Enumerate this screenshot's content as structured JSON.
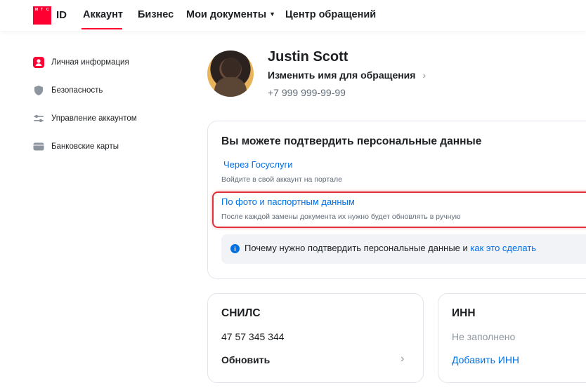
{
  "brand": {
    "logo_letters": [
      "М",
      "Т",
      "С"
    ],
    "id_label": "ID",
    "accent_color": "#ff0032"
  },
  "nav": {
    "items": [
      {
        "label": "Аккаунт",
        "active": true
      },
      {
        "label": "Бизнес"
      },
      {
        "label": "Мои документы",
        "has_dropdown": true
      },
      {
        "label": "Центр обращений"
      }
    ]
  },
  "sidebar": {
    "items": [
      {
        "label": "Личная информация",
        "icon": "user-icon",
        "active": true
      },
      {
        "label": "Безопасность",
        "icon": "shield-icon"
      },
      {
        "label": "Управление аккаунтом",
        "icon": "sliders-icon"
      },
      {
        "label": "Банковские карты",
        "icon": "card-icon"
      }
    ]
  },
  "profile": {
    "name": "Justin Scott",
    "rename_label": "Изменить имя для обращения",
    "phone": "+7 999 999-99-99"
  },
  "verify": {
    "title": "Вы можете подтвердить персональные данные",
    "option1_title": "Через Госуслуги",
    "option1_sub": "Войдите в свой аккаунт на портале",
    "option2_title": "По фото и паспортным данным",
    "option2_sub": "После каждой замены документа их нужно будет обновлять в ручную",
    "info_text": "Почему нужно подтвердить персональные данные и ",
    "info_link": "как это сделать",
    "highlight_color": "#e0303a",
    "link_color": "#0070e5"
  },
  "snils": {
    "title": "СНИЛС",
    "value": "47 57 345 344",
    "action": "Обновить"
  },
  "inn": {
    "title": "ИНН",
    "value": "Не заполнено",
    "action": "Добавить ИНН"
  }
}
